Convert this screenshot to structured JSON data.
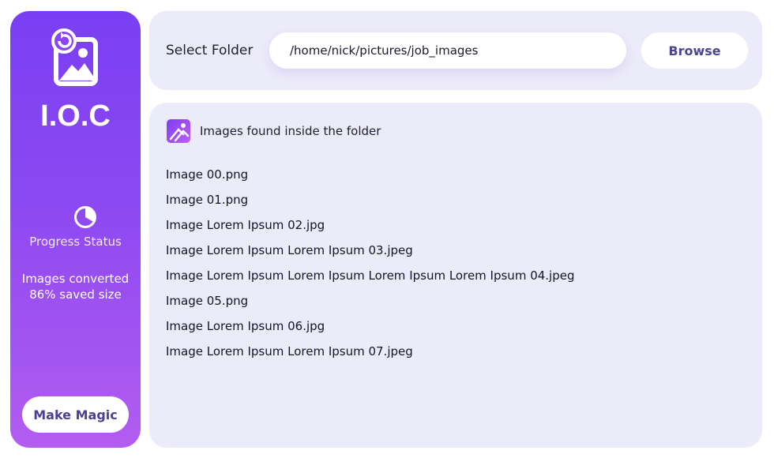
{
  "sidebar": {
    "app_title": "I.O.C",
    "logo_icon": "image-convert-icon",
    "progress_icon": "pie-progress-icon",
    "progress_label": "Progress Status",
    "stats_line1": "Images converted",
    "stats_line2": "86% saved size",
    "make_magic_label": "Make Magic"
  },
  "folder": {
    "label": "Select Folder",
    "path_value": "/home/nick/pictures/job_images",
    "browse_label": "Browse"
  },
  "images": {
    "header_icon": "image-gallery-icon",
    "header_label": "Images found inside the folder",
    "files": [
      "Image 00.png",
      "Image 01.png",
      "Image Lorem Ipsum 02.jpg",
      "Image Lorem Ipsum Lorem Ipsum 03.jpeg",
      "Image Lorem Ipsum Lorem Ipsum Lorem Ipsum Lorem Ipsum 04.jpeg",
      "Image 05.png",
      "Image Lorem Ipsum 06.jpg",
      "Image Lorem Ipsum Lorem Ipsum 07.jpeg"
    ]
  },
  "colors": {
    "sidebar_gradient_top": "#7a3ff3",
    "sidebar_gradient_bottom": "#b35df0",
    "panel_background": "#ecebf9",
    "button_text": "#4b4691"
  }
}
